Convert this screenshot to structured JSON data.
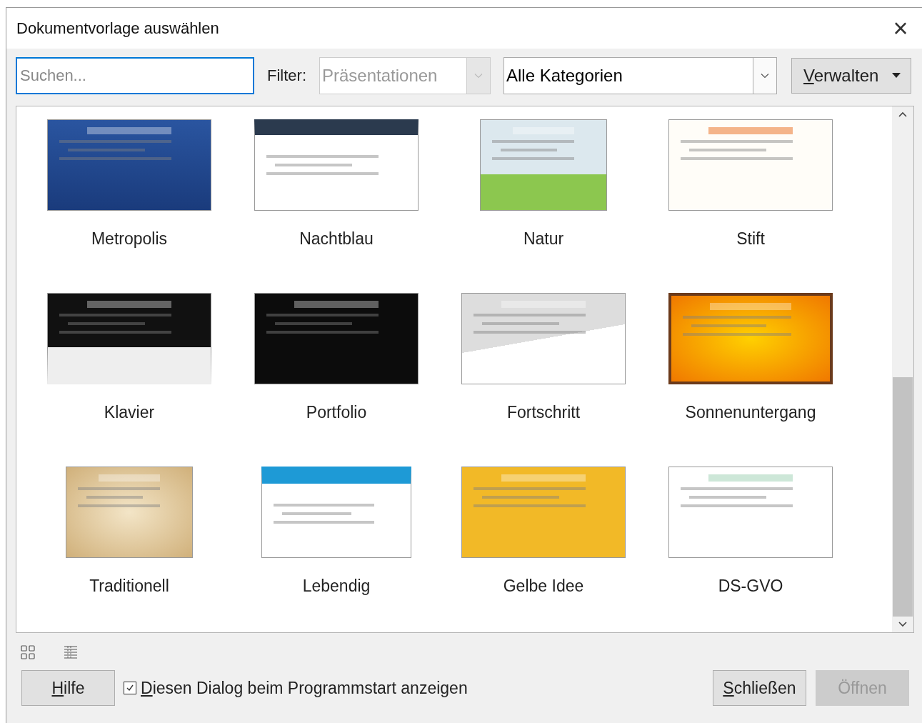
{
  "window": {
    "title": "Dokumentvorlage auswählen",
    "close": "×"
  },
  "toolbar": {
    "search": {
      "placeholder": "Suchen..."
    },
    "filter_label": "Filter:",
    "filter": {
      "value": "Präsentationen",
      "disabled": true
    },
    "category": {
      "value": "Alle Kategorien",
      "disabled": false
    },
    "manage_button": "Verwalten"
  },
  "templates": [
    {
      "name": "Metropolis"
    },
    {
      "name": "Nachtblau"
    },
    {
      "name": "Natur"
    },
    {
      "name": "Stift"
    },
    {
      "name": "Klavier"
    },
    {
      "name": "Portfolio"
    },
    {
      "name": "Fortschritt"
    },
    {
      "name": "Sonnenuntergang"
    },
    {
      "name": "Traditionell"
    },
    {
      "name": "Lebendig"
    },
    {
      "name": "Gelbe Idee"
    },
    {
      "name": "DS-GVO"
    }
  ],
  "footer": {
    "help_button": "Hilfe",
    "show_on_start": {
      "label": "Diesen Dialog beim Programmstart anzeigen",
      "checked": true
    },
    "buttons": [
      {
        "label": "Schließen",
        "disabled": false
      },
      {
        "label": "Öffnen",
        "disabled": true
      }
    ]
  }
}
